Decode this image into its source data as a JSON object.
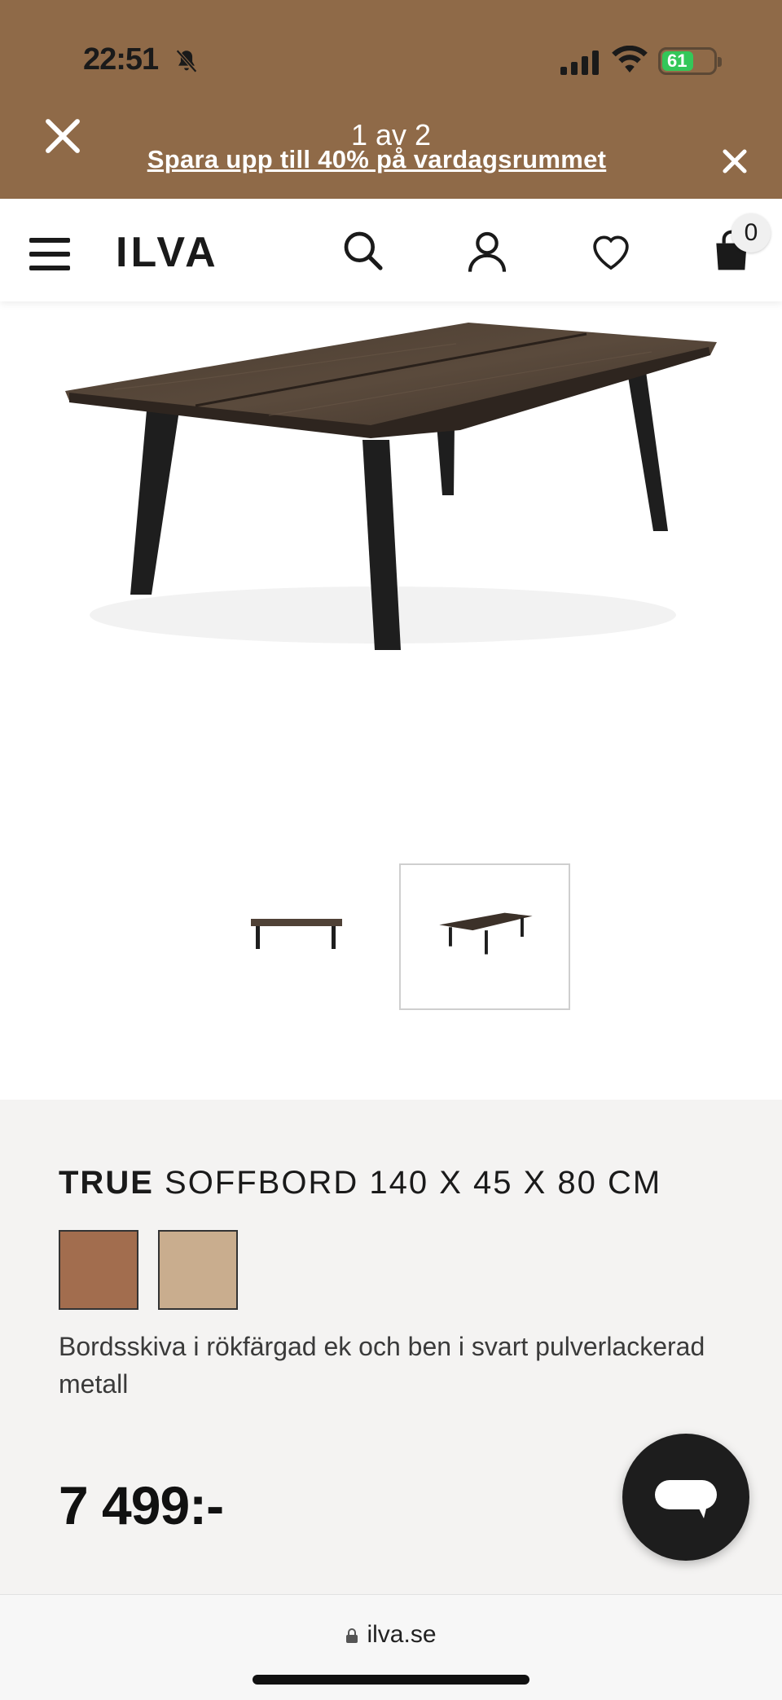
{
  "status_bar": {
    "time": "22:51",
    "battery": "61"
  },
  "gallery": {
    "counter": "1 av 2"
  },
  "promo": {
    "text": "Spara upp till 40% på vardagsrummet"
  },
  "header": {
    "logo": "ILVA",
    "cart_count": "0"
  },
  "product": {
    "brand": "TRUE",
    "name": "SOFFBORD 140 X 45 X 80 CM",
    "description": "Bordsskiva i rökfärgad ek och ben i svart pulverlackerad metall",
    "price": "7 499:-",
    "swatches": [
      {
        "color": "#a26d4e"
      },
      {
        "color": "#c9ad8e"
      }
    ]
  },
  "browser": {
    "url": "ilva.se"
  },
  "colors": {
    "promo_band": "#8f6a48",
    "info_panel": "#f4f3f2",
    "chat_button": "#1d1d1d"
  }
}
